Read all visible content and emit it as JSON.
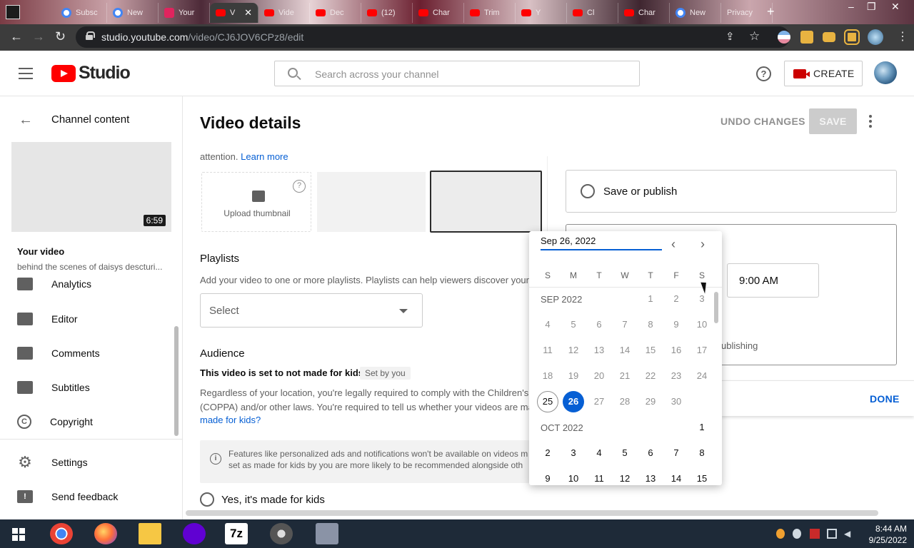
{
  "browser": {
    "tabs": [
      {
        "label": "Subsc",
        "icon": "google-icon"
      },
      {
        "label": "New",
        "icon": "chrome-icon"
      },
      {
        "label": "Your",
        "icon": "download-icon"
      },
      {
        "label": "V",
        "icon": "youtube-icon",
        "active": true
      },
      {
        "label": "Vide",
        "icon": "youtube-icon"
      },
      {
        "label": "Dec",
        "icon": "youtube-icon"
      },
      {
        "label": "(12)",
        "icon": "youtube-icon"
      },
      {
        "label": "Char",
        "icon": "youtube-icon"
      },
      {
        "label": "Trim",
        "icon": "youtube-icon"
      },
      {
        "label": "Y",
        "icon": "youtube-icon"
      },
      {
        "label": "Cl",
        "icon": "youtube-icon"
      },
      {
        "label": "Char",
        "icon": "youtube-icon"
      },
      {
        "label": "New",
        "icon": "chrome-icon"
      },
      {
        "label": "Privacy",
        "icon": "none"
      }
    ],
    "tab_close": "✕",
    "new_tab": "+",
    "url_host": "studio.youtube.com",
    "url_path": "/video/CJ6JOV6CPz8/edit"
  },
  "header": {
    "logo_text": "Studio",
    "search_placeholder": "Search across your channel",
    "create_label": "CREATE",
    "help": "?"
  },
  "sidebar": {
    "back_label": "Channel content",
    "duration": "6:59",
    "your_video": "Your video",
    "video_title": "behind the scenes of daisys descturi...",
    "items": [
      {
        "label": "Analytics",
        "icon": "analytics-icon"
      },
      {
        "label": "Editor",
        "icon": "film-icon"
      },
      {
        "label": "Comments",
        "icon": "comment-icon"
      },
      {
        "label": "Subtitles",
        "icon": "subtitles-icon"
      },
      {
        "label": "Copyright",
        "icon": "copyright-icon"
      }
    ],
    "settings": "Settings",
    "feedback": "Send feedback"
  },
  "main": {
    "title": "Video details",
    "undo": "UNDO CHANGES",
    "save": "SAVE",
    "thumb_attention": "attention.",
    "learn_more": "Learn more",
    "upload_thumbnail": "Upload thumbnail",
    "playlists": {
      "heading": "Playlists",
      "desc": "Add your video to one or more playlists. Playlists can help viewers discover your",
      "select": "Select"
    },
    "audience": {
      "heading": "Audience",
      "status": "This video is set to not made for kids",
      "set_by": "Set by you",
      "law1": "Regardless of your location, you're legally required to comply with the Children's O",
      "law2": "(COPPA) and/or other laws. You're required to tell us whether your videos are ma",
      "law_link": "made for kids?",
      "info1": "Features like personalized ads and notifications won't be available on videos m",
      "info2": "set as made for kids by you are more likely to be recommended alongside oth",
      "yes_kids": "Yes, it's made for kids"
    }
  },
  "visibility": {
    "save_publish": "Save or publish",
    "time": "9:00 AM",
    "publishing": "ublishing",
    "done": "DONE"
  },
  "datepicker": {
    "value": "Sep 26, 2022",
    "weekdays": [
      "S",
      "M",
      "T",
      "W",
      "T",
      "F",
      "S"
    ],
    "month1": "SEP 2022",
    "month2": "OCT 2022",
    "today": "25",
    "selected": "26",
    "sep_rows": [
      [
        "",
        "",
        "",
        "",
        "1",
        "2",
        "3"
      ],
      [
        "4",
        "5",
        "6",
        "7",
        "8",
        "9",
        "10"
      ],
      [
        "11",
        "12",
        "13",
        "14",
        "15",
        "16",
        "17"
      ],
      [
        "18",
        "19",
        "20",
        "21",
        "22",
        "23",
        "24"
      ],
      [
        "25",
        "26",
        "27",
        "28",
        "29",
        "30",
        ""
      ]
    ],
    "oct_rows": [
      [
        "",
        "",
        "",
        "",
        "",
        "",
        "1"
      ],
      [
        "2",
        "3",
        "4",
        "5",
        "6",
        "7",
        "8"
      ],
      [
        "9",
        "10",
        "11",
        "12",
        "13",
        "14",
        "15"
      ]
    ]
  },
  "taskbar": {
    "time": "8:44 AM",
    "date": "9/25/2022",
    "apps": [
      "chrome-icon",
      "firefox-icon",
      "file-explorer-icon",
      "yahoo-messenger-icon",
      "7zip-icon",
      "film-reel-icon",
      "pixel-app-icon"
    ],
    "seven_zip": "7z"
  },
  "colors": {
    "accent": "#065fd4",
    "brand_red": "#ff0000",
    "save_disabled": "#cccccc"
  }
}
